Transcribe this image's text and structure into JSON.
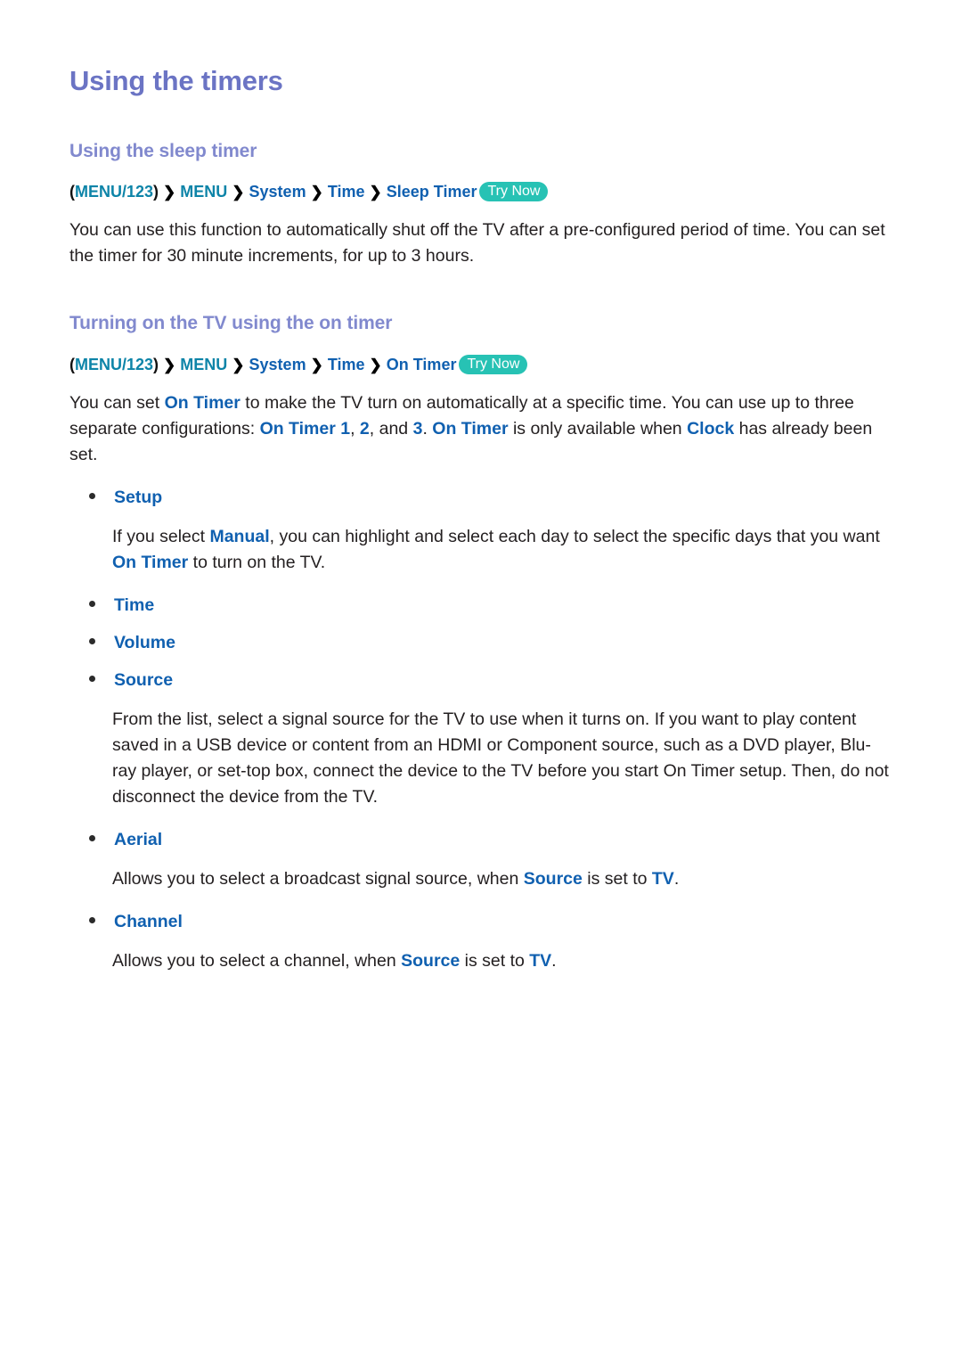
{
  "page": {
    "title": "Using the timers",
    "background_color": "#ffffff",
    "accent_colors": {
      "title_purple": "#6b74c4",
      "heading_purple": "#8189ce",
      "link_blue": "#1060b0",
      "menu_teal": "#0d84a8",
      "badge_teal": "#27c2b4",
      "body_text": "#231f20"
    }
  },
  "sections": {
    "sleep_timer": {
      "heading": "Using the sleep timer",
      "breadcrumb": {
        "open_paren": "(",
        "menu123": "MENU/123",
        "close_paren": ")",
        "separator": "❯",
        "menu": "MENU",
        "system": "System",
        "time": "Time",
        "leaf": "Sleep Timer",
        "badge": "Try Now"
      },
      "paragraph": {
        "part1": "You can use this function to automatically shut off the TV after a pre-configured period of time. You can set the timer for 30 minute increments, for up to 3 hours."
      }
    },
    "on_timer": {
      "heading": "Turning on the TV using the on timer",
      "breadcrumb": {
        "open_paren": "(",
        "menu123": "MENU/123",
        "close_paren": ")",
        "separator": "❯",
        "menu": "MENU",
        "system": "System",
        "time": "Time",
        "leaf": "On Timer",
        "badge": "Try Now"
      },
      "intro": {
        "t1": "You can set ",
        "h1": "On Timer",
        "t2": " to make the TV turn on automatically at a specific time. You can use up to three separate configurations: ",
        "h2": "On Timer 1",
        "t3": ", ",
        "h3": "2",
        "t4": ", and ",
        "h4": "3",
        "t5": ". ",
        "h5": "On Timer",
        "t6": " is only available when ",
        "h6": "Clock",
        "t7": " has already been set."
      },
      "items": [
        {
          "label": "Setup",
          "description": {
            "t1": "If you select ",
            "h1": "Manual",
            "t2": ", you can highlight and select each day to select the specific days that you want ",
            "h2": "On Timer",
            "t3": " to turn on the TV."
          }
        },
        {
          "label": "Time",
          "description": null
        },
        {
          "label": "Volume",
          "description": null
        },
        {
          "label": "Source",
          "description": {
            "t1": "From the list, select a signal source for the TV to use when it turns on. If you want to play content saved in a USB device or content from an HDMI or Component source, such as a DVD player, Blu-ray player, or set-top box, connect the device to the TV before you start On Timer setup. Then, do not disconnect the device from the TV."
          }
        },
        {
          "label": "Aerial",
          "description": {
            "t1": "Allows you to select a broadcast signal source, when ",
            "h1": "Source",
            "t2": " is set to ",
            "h2": "TV",
            "t3": "."
          }
        },
        {
          "label": "Channel",
          "description": {
            "t1": "Allows you to select a channel, when ",
            "h1": "Source",
            "t2": " is set to ",
            "h2": "TV",
            "t3": "."
          }
        }
      ]
    }
  }
}
